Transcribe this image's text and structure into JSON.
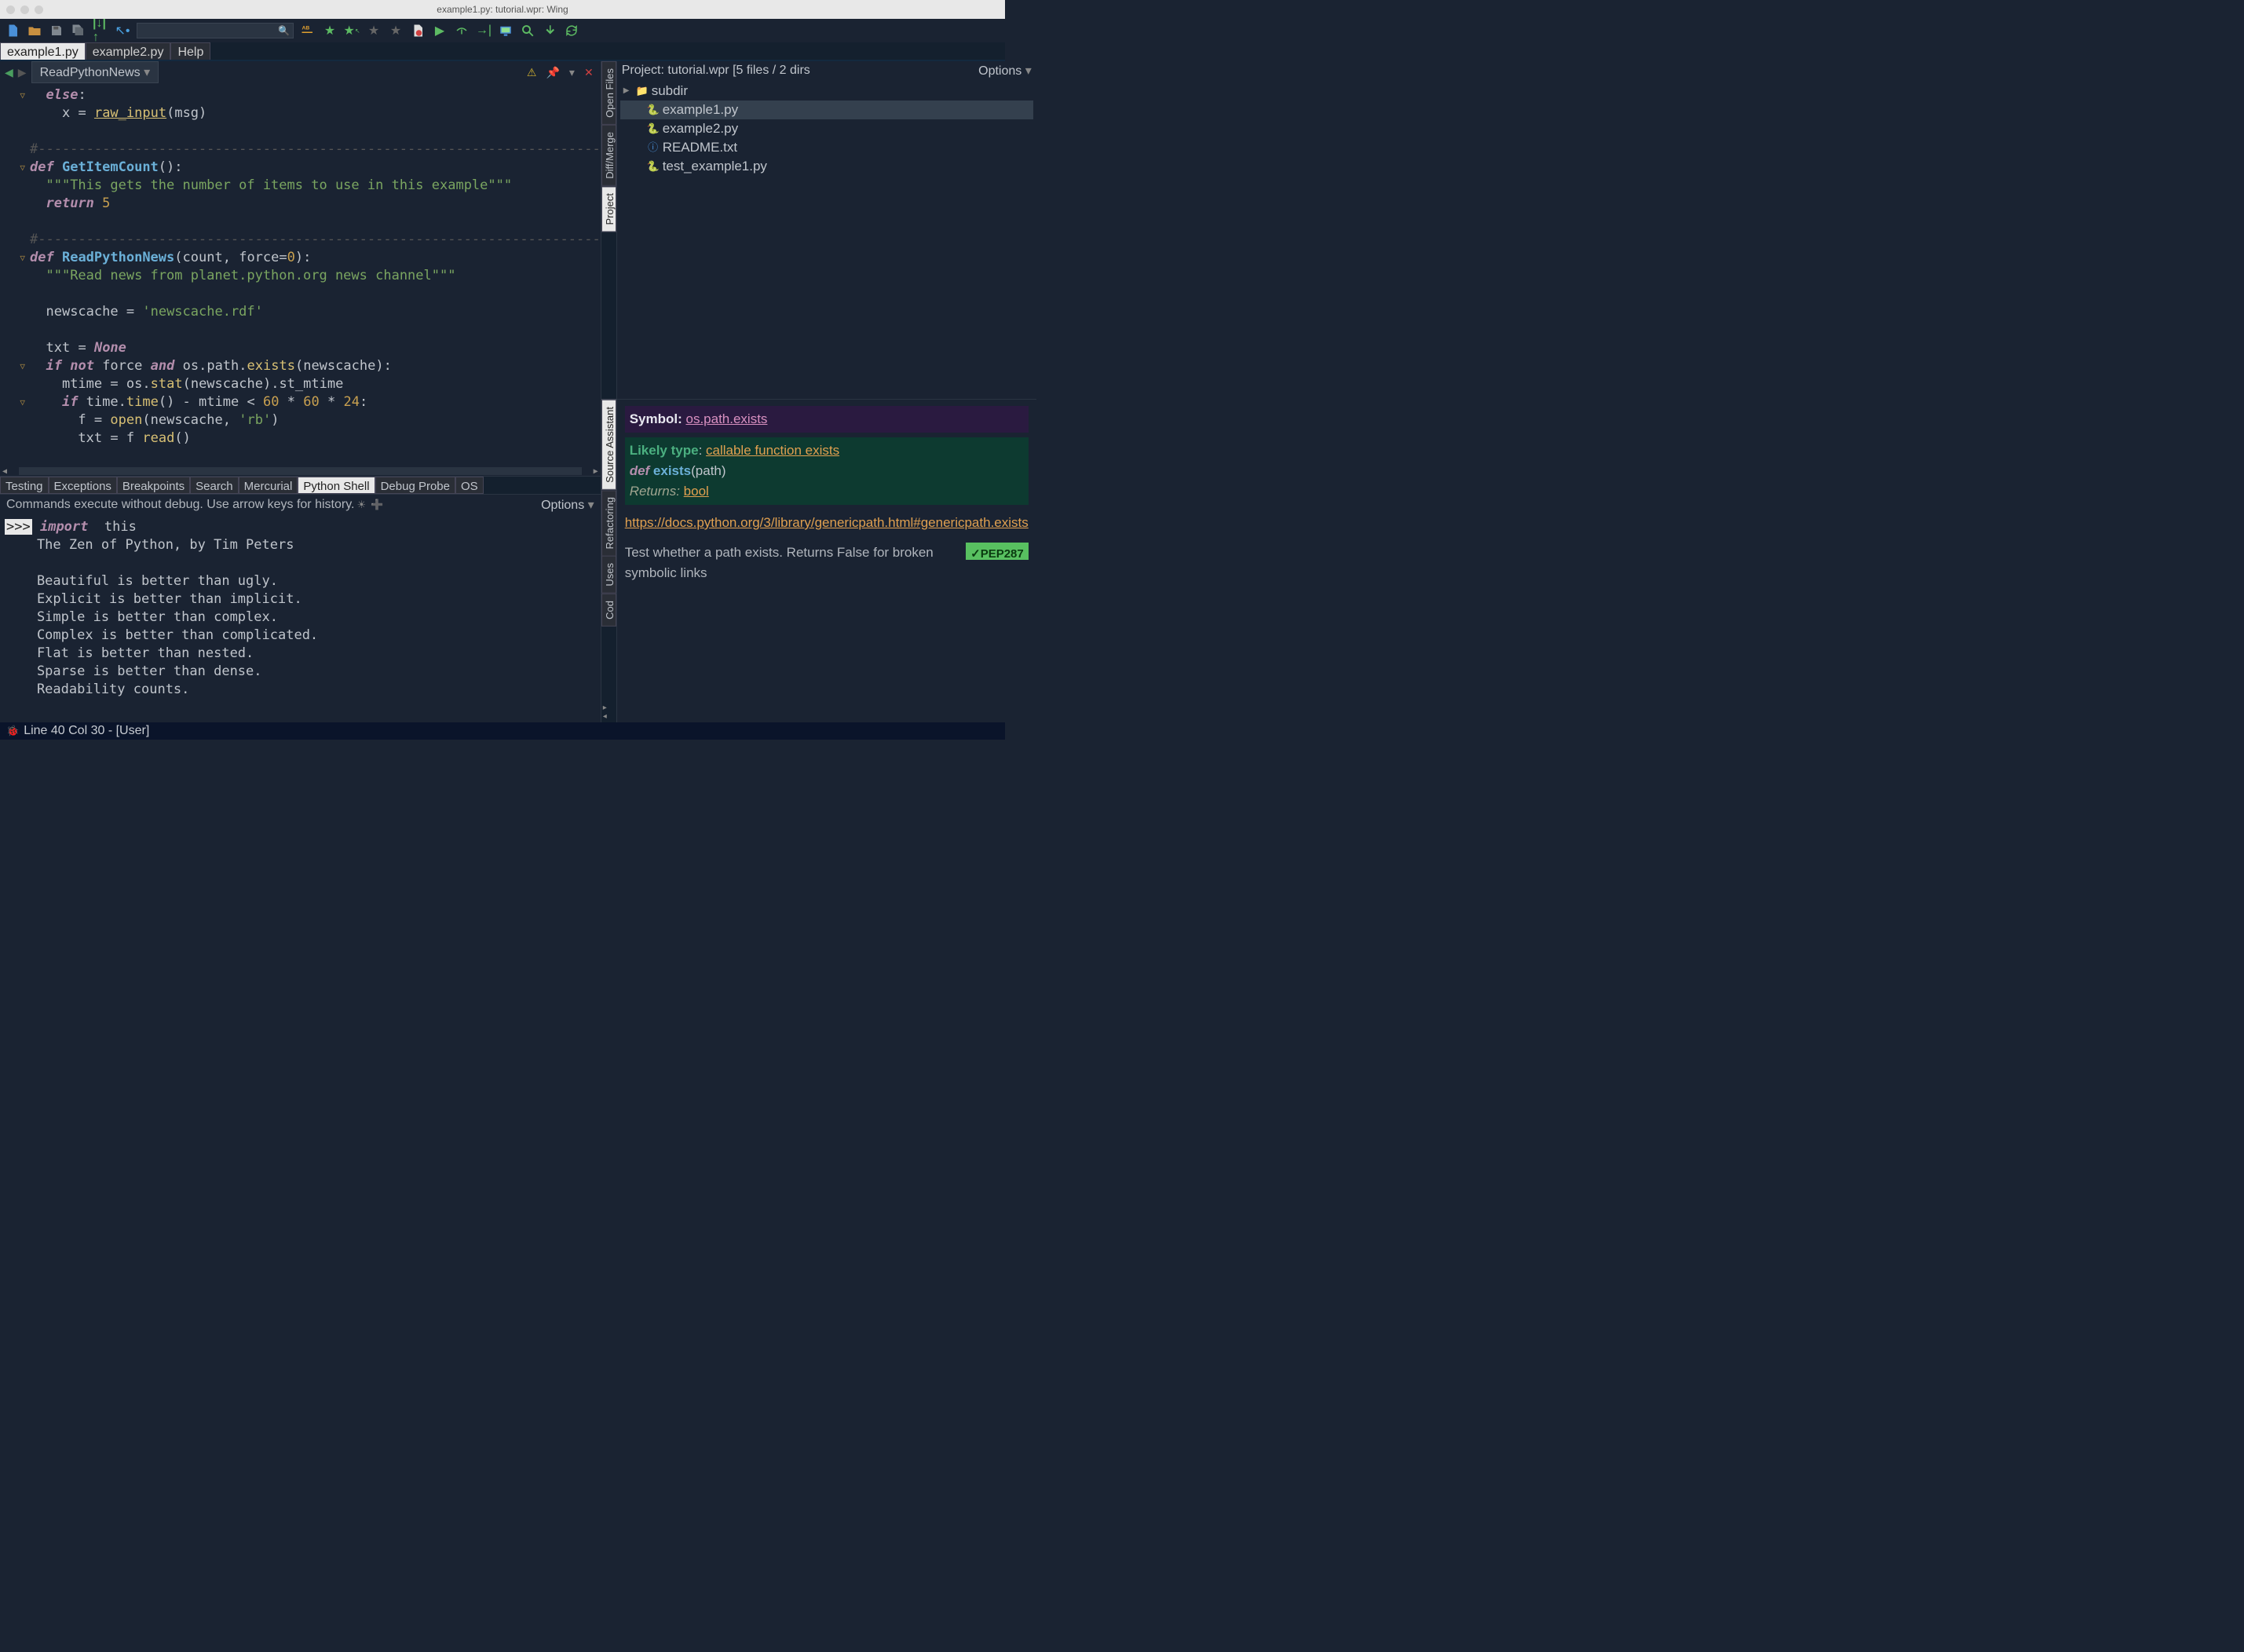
{
  "window": {
    "title": "example1.py: tutorial.wpr: Wing"
  },
  "editor_tabs": [
    {
      "label": "example1.py",
      "active": true
    },
    {
      "label": "example2.py",
      "active": false
    },
    {
      "label": "Help",
      "active": false
    }
  ],
  "navbar": {
    "symbol": "ReadPythonNews"
  },
  "code": {
    "lines": [
      {
        "fold": "▽",
        "html": "  <span class='kw'>else</span><span class='op'>:</span>"
      },
      {
        "fold": "",
        "html": "    <span class='var'>x</span> <span class='op'>=</span> <span class='call und'>raw_input</span><span class='op'>(</span><span class='var'>msg</span><span class='op'>)</span>"
      },
      {
        "fold": "",
        "html": ""
      },
      {
        "fold": "",
        "html": "<span class='cm'>#----------------------------------------------------------------------</span>"
      },
      {
        "fold": "▽",
        "html": "<span class='kw'>def</span> <span class='fn'>GetItemCount</span><span class='op'>():</span>"
      },
      {
        "fold": "",
        "html": "  <span class='str'>\"\"\"This gets the number of items to use in this example\"\"\"</span>"
      },
      {
        "fold": "",
        "html": "  <span class='kw'>return</span> <span class='num'>5</span>"
      },
      {
        "fold": "",
        "html": ""
      },
      {
        "fold": "",
        "html": "<span class='cm'>#----------------------------------------------------------------------</span>"
      },
      {
        "fold": "▽",
        "html": "<span class='kw'>def</span> <span class='fn'>ReadPythonNews</span><span class='op'>(</span><span class='var'>count</span><span class='op'>,</span> <span class='var'>force</span><span class='op'>=</span><span class='num'>0</span><span class='op'>):</span>"
      },
      {
        "fold": "",
        "html": "  <span class='str'>\"\"\"Read news from planet.python.org news channel\"\"\"</span>"
      },
      {
        "fold": "",
        "html": ""
      },
      {
        "fold": "",
        "html": "  <span class='var'>newscache</span> <span class='op'>=</span> <span class='str'>'newscache.rdf'</span>"
      },
      {
        "fold": "",
        "html": ""
      },
      {
        "fold": "",
        "html": "  <span class='var'>txt</span> <span class='op'>=</span> <span class='typekw'>None</span>"
      },
      {
        "fold": "▽",
        "html": "  <span class='kw'>if</span> <span class='kw2'>not</span> <span class='var'>force</span> <span class='kw2'>and</span> <span class='var'>os</span><span class='op'>.</span><span class='var'>path</span><span class='op'>.</span><span class='call'>exists</span><span class='op'>(</span><span class='var'>newscache</span><span class='op'>):</span>"
      },
      {
        "fold": "",
        "html": "    <span class='var'>mtime</span> <span class='op'>=</span> <span class='var'>os</span><span class='op'>.</span><span class='call'>stat</span><span class='op'>(</span><span class='var'>newscache</span><span class='op'>).</span><span class='var'>st_mtime</span>"
      },
      {
        "fold": "▽",
        "html": "    <span class='kw'>if</span> <span class='var'>time</span><span class='op'>.</span><span class='call'>time</span><span class='op'>() -</span> <span class='var'>mtime</span> <span class='op'>&lt;</span> <span class='num'>60</span> <span class='op'>*</span> <span class='num'>60</span> <span class='op'>*</span> <span class='num'>24</span><span class='op'>:</span>"
      },
      {
        "fold": "",
        "html": "      <span class='var'>f</span> <span class='op'>=</span> <span class='call'>open</span><span class='op'>(</span><span class='var'>newscache</span><span class='op'>,</span> <span class='str'>'rb'</span><span class='op'>)</span>"
      },
      {
        "fold": "",
        "html": "      <span class='var'>txt</span> <span class='op'>=</span> <span class='var'>f</span> <span class='call'>read</span><span class='op'>()</span>"
      }
    ]
  },
  "bottom_tabs": [
    {
      "label": "Testing"
    },
    {
      "label": "Exceptions"
    },
    {
      "label": "Breakpoints"
    },
    {
      "label": "Search"
    },
    {
      "label": "Mercurial"
    },
    {
      "label": "Python Shell",
      "active": true
    },
    {
      "label": "Debug Probe"
    },
    {
      "label": "OS"
    }
  ],
  "shell": {
    "hint": "Commands execute without debug.  Use arrow keys for history.",
    "options": "Options",
    "prompt": ">>>",
    "input": "import",
    "input2": "this",
    "output": "The Zen of Python, by Tim Peters\n\nBeautiful is better than ugly.\nExplicit is better than implicit.\nSimple is better than complex.\nComplex is better than complicated.\nFlat is better than nested.\nSparse is better than dense.\nReadability counts."
  },
  "right_vtabs_top": [
    {
      "label": "Project",
      "active": true
    },
    {
      "label": "Diff/Merge"
    },
    {
      "label": "Open Files"
    }
  ],
  "right_vtabs_bottom": [
    {
      "label": "Cod"
    },
    {
      "label": "Uses"
    },
    {
      "label": "Refactoring"
    },
    {
      "label": "Source Assistant",
      "active": true
    }
  ],
  "project": {
    "header": "Project: tutorial.wpr [5 files / 2 dirs",
    "options": "Options",
    "tree": [
      {
        "exp": "▶",
        "icon": "folder",
        "label": "subdir",
        "indent": 0
      },
      {
        "exp": "",
        "icon": "py",
        "label": "example1.py",
        "indent": 1,
        "sel": true
      },
      {
        "exp": "",
        "icon": "py",
        "label": "example2.py",
        "indent": 1
      },
      {
        "exp": "",
        "icon": "txt",
        "label": "README.txt",
        "indent": 1
      },
      {
        "exp": "",
        "icon": "py",
        "label": "test_example1.py",
        "indent": 1
      }
    ]
  },
  "source_assistant": {
    "symbol_label": "Symbol:",
    "symbol_link": "os.path.exists",
    "likely_type": "Likely type",
    "likely_link": "callable function exists",
    "def": "def",
    "fn": "exists",
    "args": "(path)",
    "returns_label": "Returns:",
    "returns_link": "bool",
    "doc_url": "https://docs.python.org/3/library/genericpath.html#genericpath.exists",
    "description": "Test whether a path exists. Returns False for broken symbolic links",
    "pep": "✓PEP287"
  },
  "statusbar": {
    "text": "Line 40 Col 30 - [User]"
  }
}
